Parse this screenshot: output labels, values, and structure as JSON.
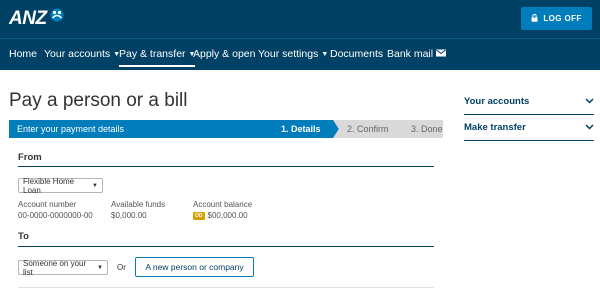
{
  "brand": {
    "name": "ANZ"
  },
  "header": {
    "logoff_label": "LOG OFF"
  },
  "nav": {
    "items": [
      {
        "label": "Home"
      },
      {
        "label": "Your accounts"
      },
      {
        "label": "Pay & transfer"
      },
      {
        "label": "Apply & open"
      },
      {
        "label": "Your settings"
      },
      {
        "label": "Documents"
      },
      {
        "label": "Bank mail"
      }
    ]
  },
  "main": {
    "title": "Pay a person or a bill",
    "progress": {
      "current_label": "Enter your payment details",
      "steps": [
        "1. Details",
        "2. Confirm",
        "3. Done"
      ]
    },
    "from": {
      "heading": "From",
      "account_select": "Flexible Home Loan",
      "account_number_label": "Account number",
      "account_number": "00-0000-0000000-00",
      "available_funds_label": "Available funds",
      "available_funds": "$0,000.00",
      "account_balance_label": "Account balance",
      "balance_badge": "OD",
      "account_balance": "$00,000.00"
    },
    "to": {
      "heading": "To",
      "payee_select": "Someone on your list",
      "or_label": "Or",
      "new_payee_button": "A new person or company"
    }
  },
  "sidebar": {
    "items": [
      {
        "label": "Your accounts"
      },
      {
        "label": "Make transfer"
      }
    ]
  },
  "colors": {
    "brand_dark": "#004165",
    "brand_blue": "#007dba",
    "step_grey": "#d9d9d9",
    "badge": "#d6a100"
  }
}
